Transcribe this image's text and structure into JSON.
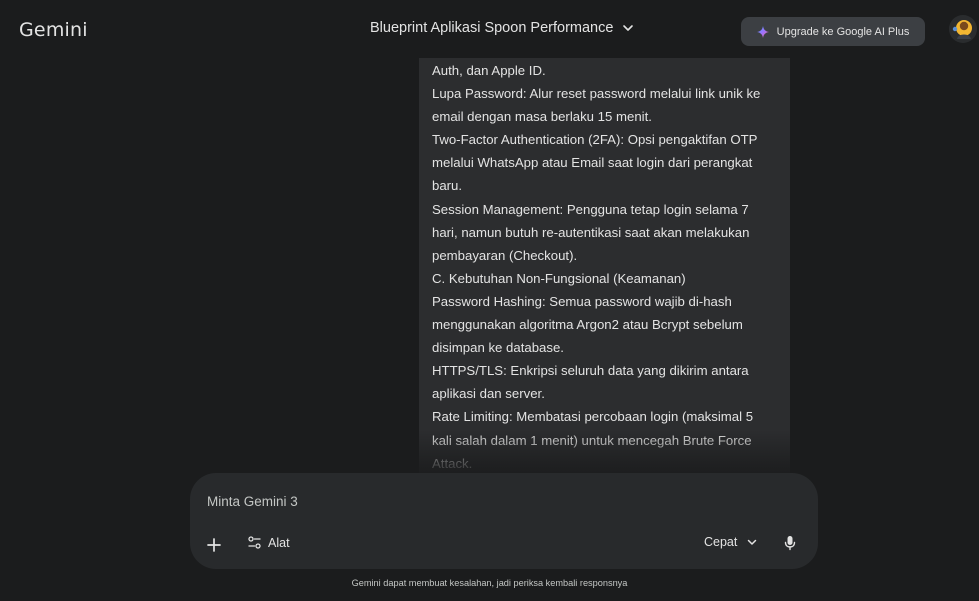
{
  "header": {
    "brand": "Gemini",
    "conversation_title": "Blueprint Aplikasi Spoon Performance",
    "upgrade_label": "Upgrade ke Google AI Plus"
  },
  "message": {
    "lines": [
      "Auth, dan Apple ID.",
      "Lupa Password: Alur reset password melalui link unik ke",
      "email dengan masa berlaku 15 menit.",
      "Two-Factor Authentication (2FA): Opsi pengaktifan OTP",
      "melalui WhatsApp atau Email saat login dari perangkat",
      "baru.",
      "Session Management: Pengguna tetap login selama 7",
      "hari, namun butuh re-autentikasi saat akan melakukan",
      "pembayaran (Checkout).",
      "C. Kebutuhan Non-Fungsional (Keamanan)",
      "Password Hashing: Semua password wajib di-hash",
      "menggunakan algoritma Argon2 atau Bcrypt sebelum",
      "disimpan ke database.",
      "HTTPS/TLS: Enkripsi seluruh data yang dikirim antara",
      "aplikasi dan server.",
      "Rate Limiting: Membatasi percobaan login (maksimal 5",
      "kali salah dalam 1 menit) untuk mencegah Brute Force",
      "Attack."
    ]
  },
  "composer": {
    "placeholder": "Minta Gemini 3",
    "tools_label": "Alat",
    "mode_label": "Cepat"
  },
  "footer": {
    "disclaimer": "Gemini dapat membuat kesalahan, jadi periksa kembali responsnya"
  },
  "icons": {
    "title_chevron": "chevron-down-icon",
    "upgrade": "sparkle-icon",
    "plus": "plus-icon",
    "tools": "tune-icon",
    "mode_chevron": "chevron-down-icon",
    "mic": "microphone-icon"
  },
  "colors": {
    "background": "#1b1c1d",
    "message_bubble": "#2c2d2f",
    "composer": "#282a2c",
    "upgrade_button": "#3c3f43",
    "text": "#e3e3e3"
  }
}
